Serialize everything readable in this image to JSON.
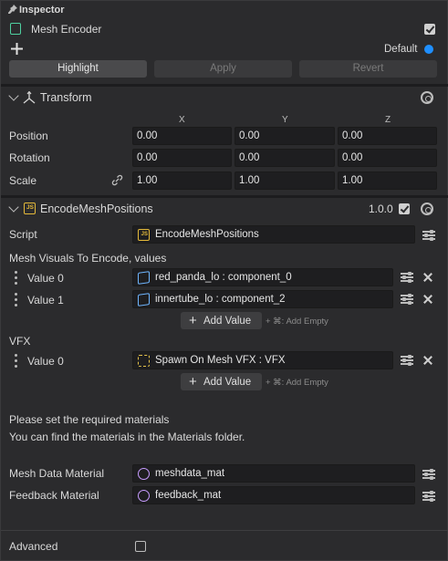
{
  "panel": {
    "title": "Inspector"
  },
  "object": {
    "name": "Mesh Encoder",
    "enabled": true,
    "layer": "Default"
  },
  "toolbar": {
    "highlight_label": "Highlight",
    "apply_label": "Apply",
    "revert_label": "Revert"
  },
  "transform": {
    "title": "Transform",
    "axes": [
      "X",
      "Y",
      "Z"
    ],
    "position": {
      "label": "Position",
      "values": [
        "0.00",
        "0.00",
        "0.00"
      ]
    },
    "rotation": {
      "label": "Rotation",
      "values": [
        "0.00",
        "0.00",
        "0.00"
      ]
    },
    "scale": {
      "label": "Scale",
      "values": [
        "1.00",
        "1.00",
        "1.00"
      ]
    }
  },
  "script_component": {
    "title": "EncodeMeshPositions",
    "version": "1.0.0",
    "enabled": true,
    "script_label": "Script",
    "script_value": "EncodeMeshPositions",
    "mesh_visuals_label": "Mesh Visuals To Encode, values",
    "mesh_items": [
      {
        "label": "Value 0",
        "value": "red_panda_lo : component_0"
      },
      {
        "label": "Value 1",
        "value": "innertube_lo : component_2"
      }
    ],
    "add_value_label": "Add Value",
    "add_empty_hint": "+ ⌘: Add Empty",
    "vfx_label": "VFX",
    "vfx_items": [
      {
        "label": "Value 0",
        "value": "Spawn On Mesh VFX : VFX"
      }
    ],
    "note_line1": "Please set the required materials",
    "note_line2": "You can find the materials in the Materials folder.",
    "mesh_data_material_label": "Mesh Data Material",
    "mesh_data_material_value": "meshdata_mat",
    "feedback_material_label": "Feedback Material",
    "feedback_material_value": "feedback_mat",
    "advanced_label": "Advanced",
    "advanced_checked": false
  },
  "colors": {
    "accent": "#1f8fff",
    "script_icon": "#e4b93a",
    "mesh_icon": "#6fb6ff",
    "material_icon": "#c79cff"
  }
}
